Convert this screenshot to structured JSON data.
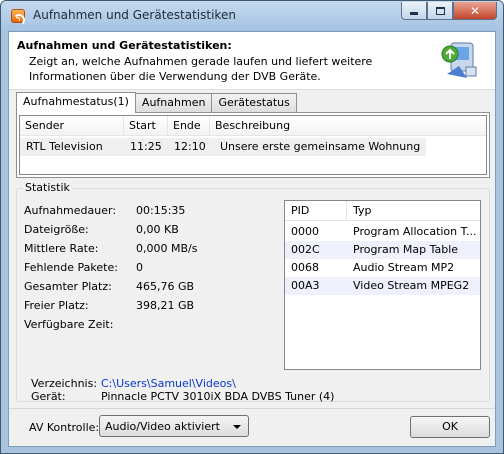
{
  "window": {
    "title": "Aufnahmen und Gerätestatistiken",
    "controls": {
      "minimize": "minimize",
      "maximize": "maximize",
      "close": "✕"
    }
  },
  "header": {
    "title": "Aufnahmen und Gerätestatistiken:",
    "description": "Zeigt an, welche Aufnahmen gerade laufen und liefert weitere Informationen über die Verwendung der DVB Geräte.",
    "icon": "device-arrows-icon"
  },
  "tabs": [
    {
      "label": "Aufnahmestatus(1)",
      "active": true
    },
    {
      "label": "Aufnahmen",
      "active": false
    },
    {
      "label": "Gerätestatus",
      "active": false
    }
  ],
  "recordings": {
    "columns": [
      "Sender",
      "Start",
      "Ende",
      "Beschreibung"
    ],
    "rows": [
      {
        "sender": "RTL Television",
        "start": "11:25",
        "end": "12:10",
        "description": "Unsere erste gemeinsame Wohnung"
      }
    ]
  },
  "statistics": {
    "title": "Statistik",
    "items": [
      {
        "label": "Aufnahmedauer:",
        "value": "00:15:35"
      },
      {
        "label": "Dateigröße:",
        "value": "0,00 KB"
      },
      {
        "label": "Mittlere Rate:",
        "value": "0,000 MB/s"
      },
      {
        "label": "Fehlende Pakete:",
        "value": "0"
      },
      {
        "label": "Gesamter Platz:",
        "value": "465,76 GB"
      },
      {
        "label": "Freier Platz:",
        "value": "398,21 GB"
      },
      {
        "label": "Verfügbare Zeit:",
        "value": ""
      }
    ],
    "pid_columns": [
      "PID",
      "Typ"
    ],
    "pids": [
      {
        "pid": "0000",
        "type": "Program Allocation T..."
      },
      {
        "pid": "002C",
        "type": "Program Map Table"
      },
      {
        "pid": "0068",
        "type": "Audio Stream MP2"
      },
      {
        "pid": "00A3",
        "type": "Video Stream MPEG2"
      }
    ],
    "directory_label": "Verzeichnis:",
    "directory_value": "C:\\Users\\Samuel\\Videos\\",
    "device_label": "Gerät:",
    "device_value": "Pinnacle PCTV 3010iX BDA DVBS Tuner (4)"
  },
  "footer": {
    "av_label": "AV Kontrolle:",
    "av_selected": "Audio/Video aktiviert",
    "ok_label": "OK"
  },
  "colors": {
    "link": "#0a36c8",
    "titlebar": "#b6cde7",
    "accent_stripe": "#eef0fb"
  }
}
